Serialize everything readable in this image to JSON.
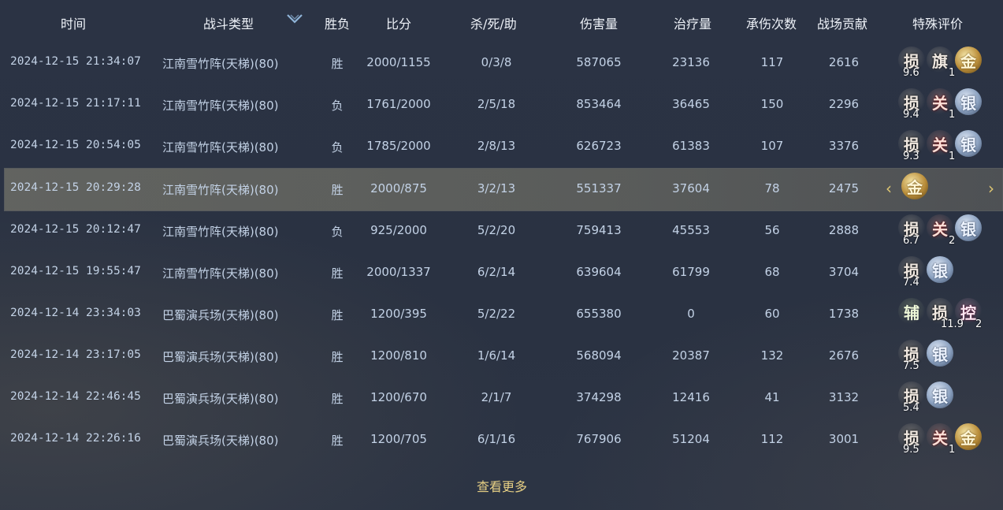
{
  "headers": {
    "time": "时间",
    "type": "战斗类型",
    "result": "胜负",
    "score": "比分",
    "kda": "杀/死/助",
    "damage": "伤害量",
    "heal": "治疗量",
    "hits": "承伤次数",
    "contrib": "战场贡献",
    "rating": "特殊评价"
  },
  "rows": [
    {
      "time": "2024-12-15 21:34:07",
      "type": "江南雪竹阵(天梯)(80)",
      "result": "胜",
      "score": "2000/1155",
      "kda": "0/3/8",
      "damage": "587065",
      "heal": "23136",
      "hits": "117",
      "contrib": "2616",
      "badges": [
        {
          "char": "损",
          "style": "plain"
        },
        {
          "char": "旗",
          "style": "plain"
        },
        {
          "char": "金",
          "style": "gold"
        }
      ],
      "num1": "9.6",
      "num2": "1"
    },
    {
      "time": "2024-12-15 21:17:11",
      "type": "江南雪竹阵(天梯)(80)",
      "result": "负",
      "score": "1761/2000",
      "kda": "2/5/18",
      "damage": "853464",
      "heal": "36465",
      "hits": "150",
      "contrib": "2296",
      "badges": [
        {
          "char": "损",
          "style": "plain"
        },
        {
          "char": "关",
          "style": "red"
        },
        {
          "char": "银",
          "style": "silver"
        }
      ],
      "num1": "9.4",
      "num2": "1"
    },
    {
      "time": "2024-12-15 20:54:05",
      "type": "江南雪竹阵(天梯)(80)",
      "result": "负",
      "score": "1785/2000",
      "kda": "2/8/13",
      "damage": "626723",
      "heal": "61383",
      "hits": "107",
      "contrib": "3376",
      "badges": [
        {
          "char": "损",
          "style": "plain"
        },
        {
          "char": "关",
          "style": "red"
        },
        {
          "char": "银",
          "style": "silver"
        }
      ],
      "num1": "9.3",
      "num2": "1"
    },
    {
      "time": "2024-12-15 20:29:28",
      "type": "江南雪竹阵(天梯)(80)",
      "result": "胜",
      "score": "2000/875",
      "kda": "3/2/13",
      "damage": "551337",
      "heal": "37604",
      "hits": "78",
      "contrib": "2475",
      "badges": [
        {
          "char": "金",
          "style": "gold"
        }
      ],
      "num1": "",
      "num2": ""
    },
    {
      "time": "2024-12-15 20:12:47",
      "type": "江南雪竹阵(天梯)(80)",
      "result": "负",
      "score": "925/2000",
      "kda": "5/2/20",
      "damage": "759413",
      "heal": "45553",
      "hits": "56",
      "contrib": "2888",
      "badges": [
        {
          "char": "损",
          "style": "plain"
        },
        {
          "char": "关",
          "style": "red"
        },
        {
          "char": "银",
          "style": "silver"
        }
      ],
      "num1": "6.7",
      "num2": "2"
    },
    {
      "time": "2024-12-15 19:55:47",
      "type": "江南雪竹阵(天梯)(80)",
      "result": "胜",
      "score": "2000/1337",
      "kda": "6/2/14",
      "damage": "639604",
      "heal": "61799",
      "hits": "68",
      "contrib": "3704",
      "badges": [
        {
          "char": "损",
          "style": "plain"
        },
        {
          "char": "银",
          "style": "silver"
        }
      ],
      "num1": "7.4",
      "num2": ""
    },
    {
      "time": "2024-12-14 23:34:03",
      "type": "巴蜀演兵场(天梯)(80)",
      "result": "胜",
      "score": "1200/395",
      "kda": "5/2/22",
      "damage": "655380",
      "heal": "0",
      "hits": "60",
      "contrib": "1738",
      "badges": [
        {
          "char": "辅",
          "style": "green"
        },
        {
          "char": "损",
          "style": "plain"
        },
        {
          "char": "控",
          "style": "pink"
        }
      ],
      "num1": "11.9",
      "num2": "2"
    },
    {
      "time": "2024-12-14 23:17:05",
      "type": "巴蜀演兵场(天梯)(80)",
      "result": "胜",
      "score": "1200/810",
      "kda": "1/6/14",
      "damage": "568094",
      "heal": "20387",
      "hits": "132",
      "contrib": "2676",
      "badges": [
        {
          "char": "损",
          "style": "plain"
        },
        {
          "char": "银",
          "style": "silver"
        }
      ],
      "num1": "7.5",
      "num2": ""
    },
    {
      "time": "2024-12-14 22:46:45",
      "type": "巴蜀演兵场(天梯)(80)",
      "result": "胜",
      "score": "1200/670",
      "kda": "2/1/7",
      "damage": "374298",
      "heal": "12416",
      "hits": "41",
      "contrib": "3132",
      "badges": [
        {
          "char": "损",
          "style": "plain"
        },
        {
          "char": "银",
          "style": "silver"
        }
      ],
      "num1": "5.4",
      "num2": ""
    },
    {
      "time": "2024-12-14 22:26:16",
      "type": "巴蜀演兵场(天梯)(80)",
      "result": "胜",
      "score": "1200/705",
      "kda": "6/1/16",
      "damage": "767906",
      "heal": "51204",
      "hits": "112",
      "contrib": "3001",
      "badges": [
        {
          "char": "损",
          "style": "plain"
        },
        {
          "char": "关",
          "style": "red"
        },
        {
          "char": "金",
          "style": "gold"
        }
      ],
      "num1": "9.5",
      "num2": "1"
    }
  ],
  "nav": {
    "prev_icon": "chevron-left-icon",
    "next_icon": "chevron-right-icon",
    "prev_glyph": "‹",
    "next_glyph": "›"
  },
  "more_label": "查看更多",
  "colors": {
    "accent": "#e6cf84",
    "gold_badge": "#c9a24a",
    "silver_badge": "#8aa0bf",
    "selected_row": "#8f8a74"
  }
}
